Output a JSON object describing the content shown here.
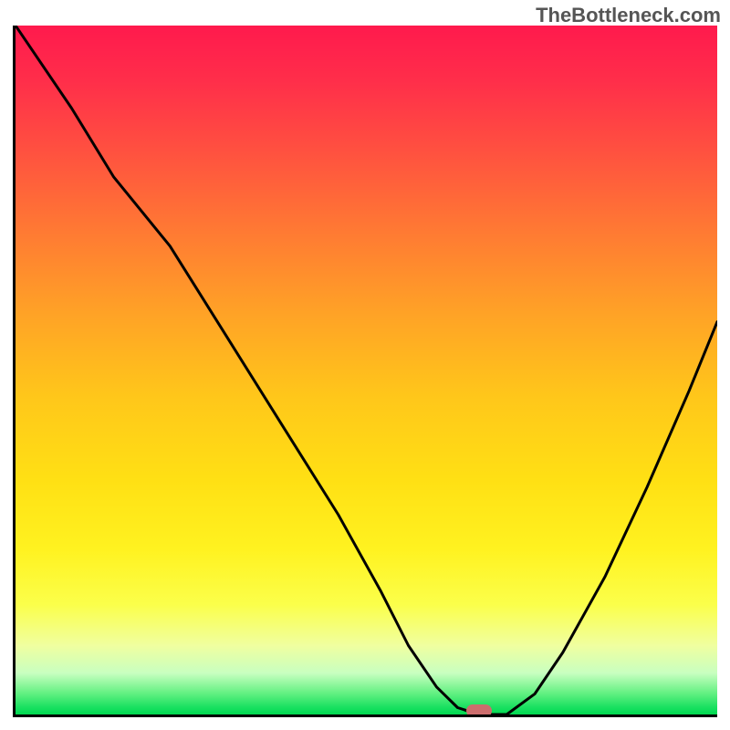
{
  "attribution": "TheBottleneck.com",
  "colors": {
    "gradient_top": "#ff1a4d",
    "gradient_mid": "#ffd21a",
    "gradient_bottom": "#18e060",
    "curve": "#000000",
    "marker": "#cc6d6d",
    "axis": "#000000"
  },
  "chart_data": {
    "type": "line",
    "title": "",
    "xlabel": "",
    "ylabel": "",
    "xlim": [
      0,
      100
    ],
    "ylim": [
      0,
      100
    ],
    "legend": false,
    "grid": false,
    "series": [
      {
        "name": "bottleneck-curve",
        "x": [
          0,
          8,
          14,
          22,
          30,
          38,
          46,
          52,
          56,
          60,
          63,
          66,
          70,
          74,
          78,
          84,
          90,
          96,
          100
        ],
        "values": [
          100,
          88,
          78,
          68,
          55,
          42,
          29,
          18,
          10,
          4,
          1,
          0,
          0,
          3,
          9,
          20,
          33,
          47,
          57
        ]
      }
    ],
    "marker": {
      "x": 66,
      "y": 0
    },
    "annotations": []
  }
}
